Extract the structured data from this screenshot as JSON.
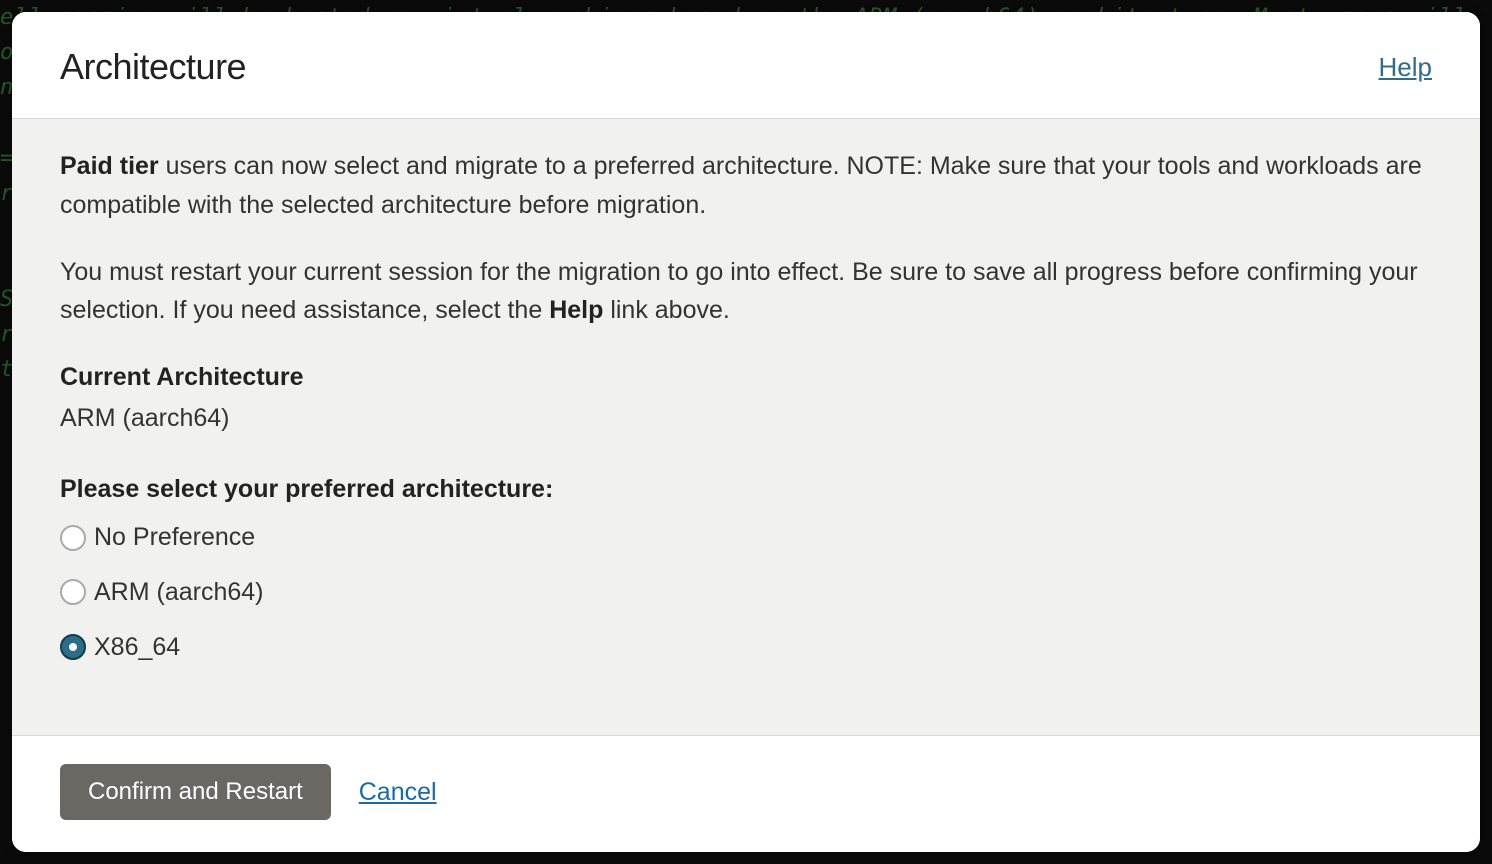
{
  "modal": {
    "title": "Architecture",
    "help_link": "Help",
    "para1_bold": "Paid tier",
    "para1_rest": " users can now select and migrate to a preferred architecture. NOTE: Make sure that your tools and workloads are compatible with the selected architecture before migration.",
    "para2_part1": "You must restart your current session for the migration to go into effect. Be sure to save all progress before confirming your selection. If you need assistance, select the ",
    "para2_bold": "Help",
    "para2_part2": " link above.",
    "current_arch_label": "Current Architecture",
    "current_arch_value": "ARM (aarch64)",
    "select_label": "Please select your preferred architecture:",
    "options": [
      {
        "label": "No Preference",
        "selected": false
      },
      {
        "label": "ARM (aarch64)",
        "selected": false
      },
      {
        "label": "X86_64",
        "selected": true
      }
    ],
    "confirm_button": "Confirm and Restart",
    "cancel_link": "Cancel"
  }
}
